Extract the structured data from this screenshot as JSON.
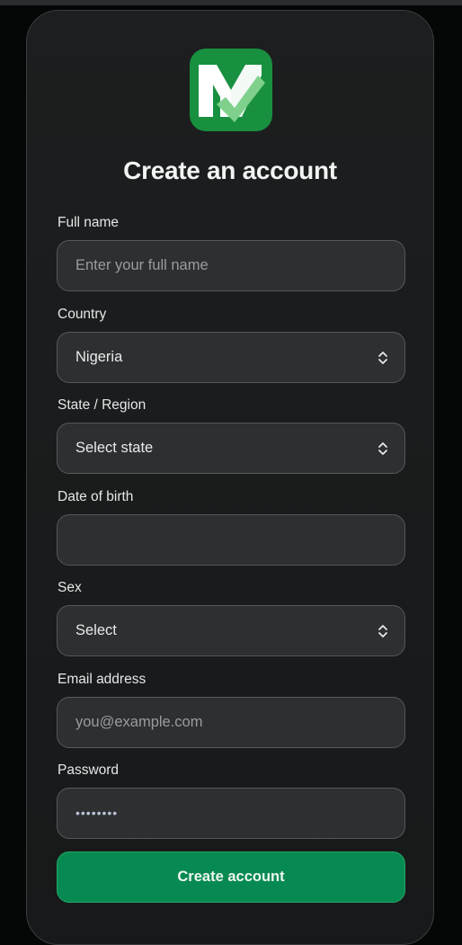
{
  "page": {
    "title": "Create an account"
  },
  "logo": {
    "icon": "m-checkmark-logo",
    "color": "#18903f"
  },
  "form": {
    "full_name": {
      "label": "Full name",
      "placeholder": "Enter your full name",
      "value": ""
    },
    "country": {
      "label": "Country",
      "value": "Nigeria"
    },
    "state": {
      "label": "State / Region",
      "value": "Select state"
    },
    "dob": {
      "label": "Date of birth",
      "value": ""
    },
    "sex": {
      "label": "Sex",
      "value": "Select"
    },
    "email": {
      "label": "Email address",
      "placeholder": "you@example.com",
      "value": ""
    },
    "password": {
      "label": "Password",
      "masked_value": "••••••••"
    },
    "submit_label": "Create account"
  },
  "colors": {
    "accent": "#078a52",
    "background": "#050606",
    "card": "#1b1c1d"
  }
}
